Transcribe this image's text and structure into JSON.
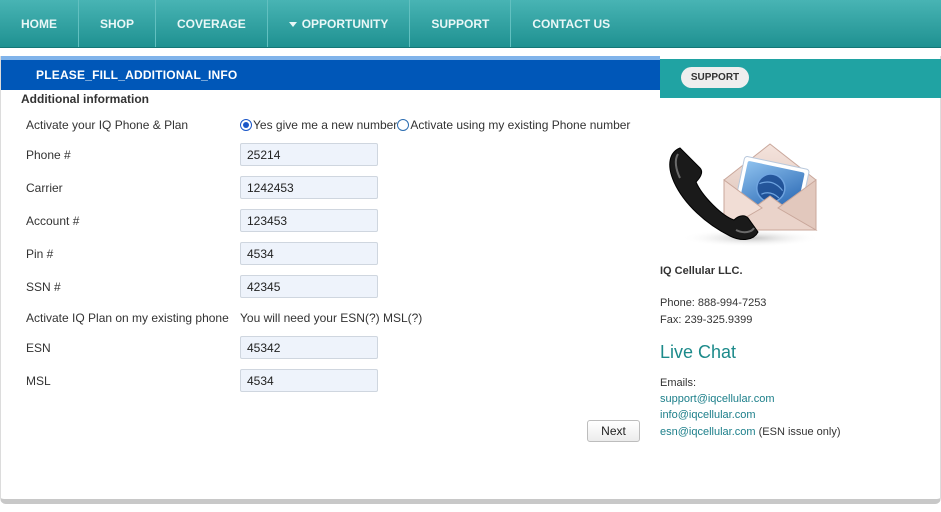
{
  "nav": {
    "items": [
      "HOME",
      "SHOP",
      "COVERAGE",
      "OPPORTUNITY",
      "SUPPORT",
      "CONTACT US"
    ]
  },
  "title_bar": {
    "title": "PLEASE_FILL_ADDITIONAL_INFO"
  },
  "support_tab": {
    "label": "SUPPORT"
  },
  "form": {
    "heading": "Additional information",
    "activate_label": "Activate your IQ Phone & Plan",
    "radio_new": "Yes give me a new number",
    "radio_existing": "Activate using my existing Phone number",
    "selected_option": "new",
    "phone_label": "Phone #",
    "phone_value": "25214",
    "carrier_label": "Carrier",
    "carrier_value": "1242453",
    "account_label": "Account #",
    "account_value": "123453",
    "pin_label": "Pin #",
    "pin_value": "4534",
    "ssn_label": "SSN #",
    "ssn_value": "42345",
    "existing_phone_label": "Activate IQ Plan on my existing phone",
    "esn_hint": "You will need your ESN(?) MSL(?)",
    "esn_label": "ESN",
    "esn_value": "45342",
    "msl_label": "MSL",
    "msl_value": "4534",
    "next_label": "Next"
  },
  "contact": {
    "company": "IQ Cellular LLC.",
    "phone": "Phone: 888-994-7253",
    "fax": "Fax: 239-325.9399",
    "live_chat": "Live Chat",
    "emails_label": "Emails:",
    "emails": [
      "support@iqcellular.com",
      "info@iqcellular.com",
      "esn@iqcellular.com"
    ],
    "esn_note": "(ESN issue only)"
  },
  "colors": {
    "nav_bg": "#2a9d9d",
    "title_bar_bg": "#0057b8",
    "support_bar_bg": "#20a3a3",
    "link": "#1c7f8a"
  }
}
